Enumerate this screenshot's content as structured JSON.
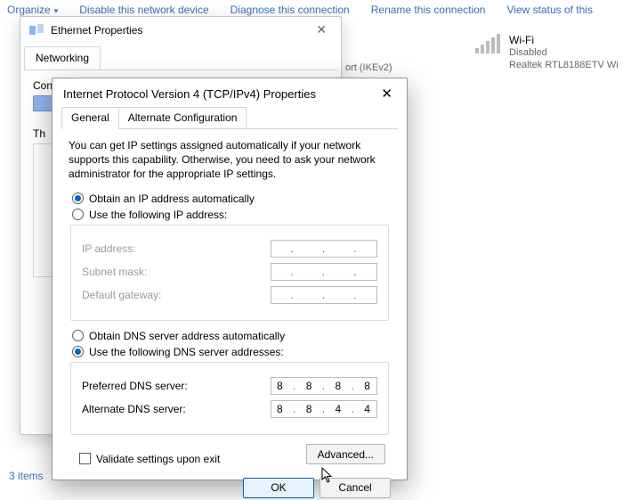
{
  "cmdbar": {
    "organize": "Organize",
    "disable": "Disable this network device",
    "diagnose": "Diagnose this connection",
    "rename": "Rename this connection",
    "status": "View status of this"
  },
  "wifi": {
    "name": "Wi-Fi",
    "state": "Disabled",
    "adapter": "Realtek RTL8188ETV Wi"
  },
  "ethernet_dialog": {
    "title": "Ethernet Properties",
    "tab": "Networking",
    "connect_label": "Connect using:",
    "this_label": "Th"
  },
  "ikev": "ort (IKEv2)",
  "ipv4": {
    "title": "Internet Protocol Version 4 (TCP/IPv4) Properties",
    "tabs": {
      "general": "General",
      "alt": "Alternate Configuration"
    },
    "desc": "You can get IP settings assigned automatically if your network supports this capability. Otherwise, you need to ask your network administrator for the appropriate IP settings.",
    "ip": {
      "auto": "Obtain an IP address automatically",
      "manual": "Use the following IP address:",
      "ip_label": "IP address:",
      "subnet_label": "Subnet mask:",
      "gateway_label": "Default gateway:"
    },
    "dns": {
      "auto": "Obtain DNS server address automatically",
      "manual": "Use the following DNS server addresses:",
      "pref_label": "Preferred DNS server:",
      "alt_label": "Alternate DNS server:",
      "pref": {
        "a": "8",
        "b": "8",
        "c": "8",
        "d": "8"
      },
      "altv": {
        "a": "8",
        "b": "8",
        "c": "4",
        "d": "4"
      }
    },
    "validate": "Validate settings upon exit",
    "advanced": "Advanced...",
    "ok": "OK",
    "cancel": "Cancel"
  },
  "status_strip": "3 items"
}
